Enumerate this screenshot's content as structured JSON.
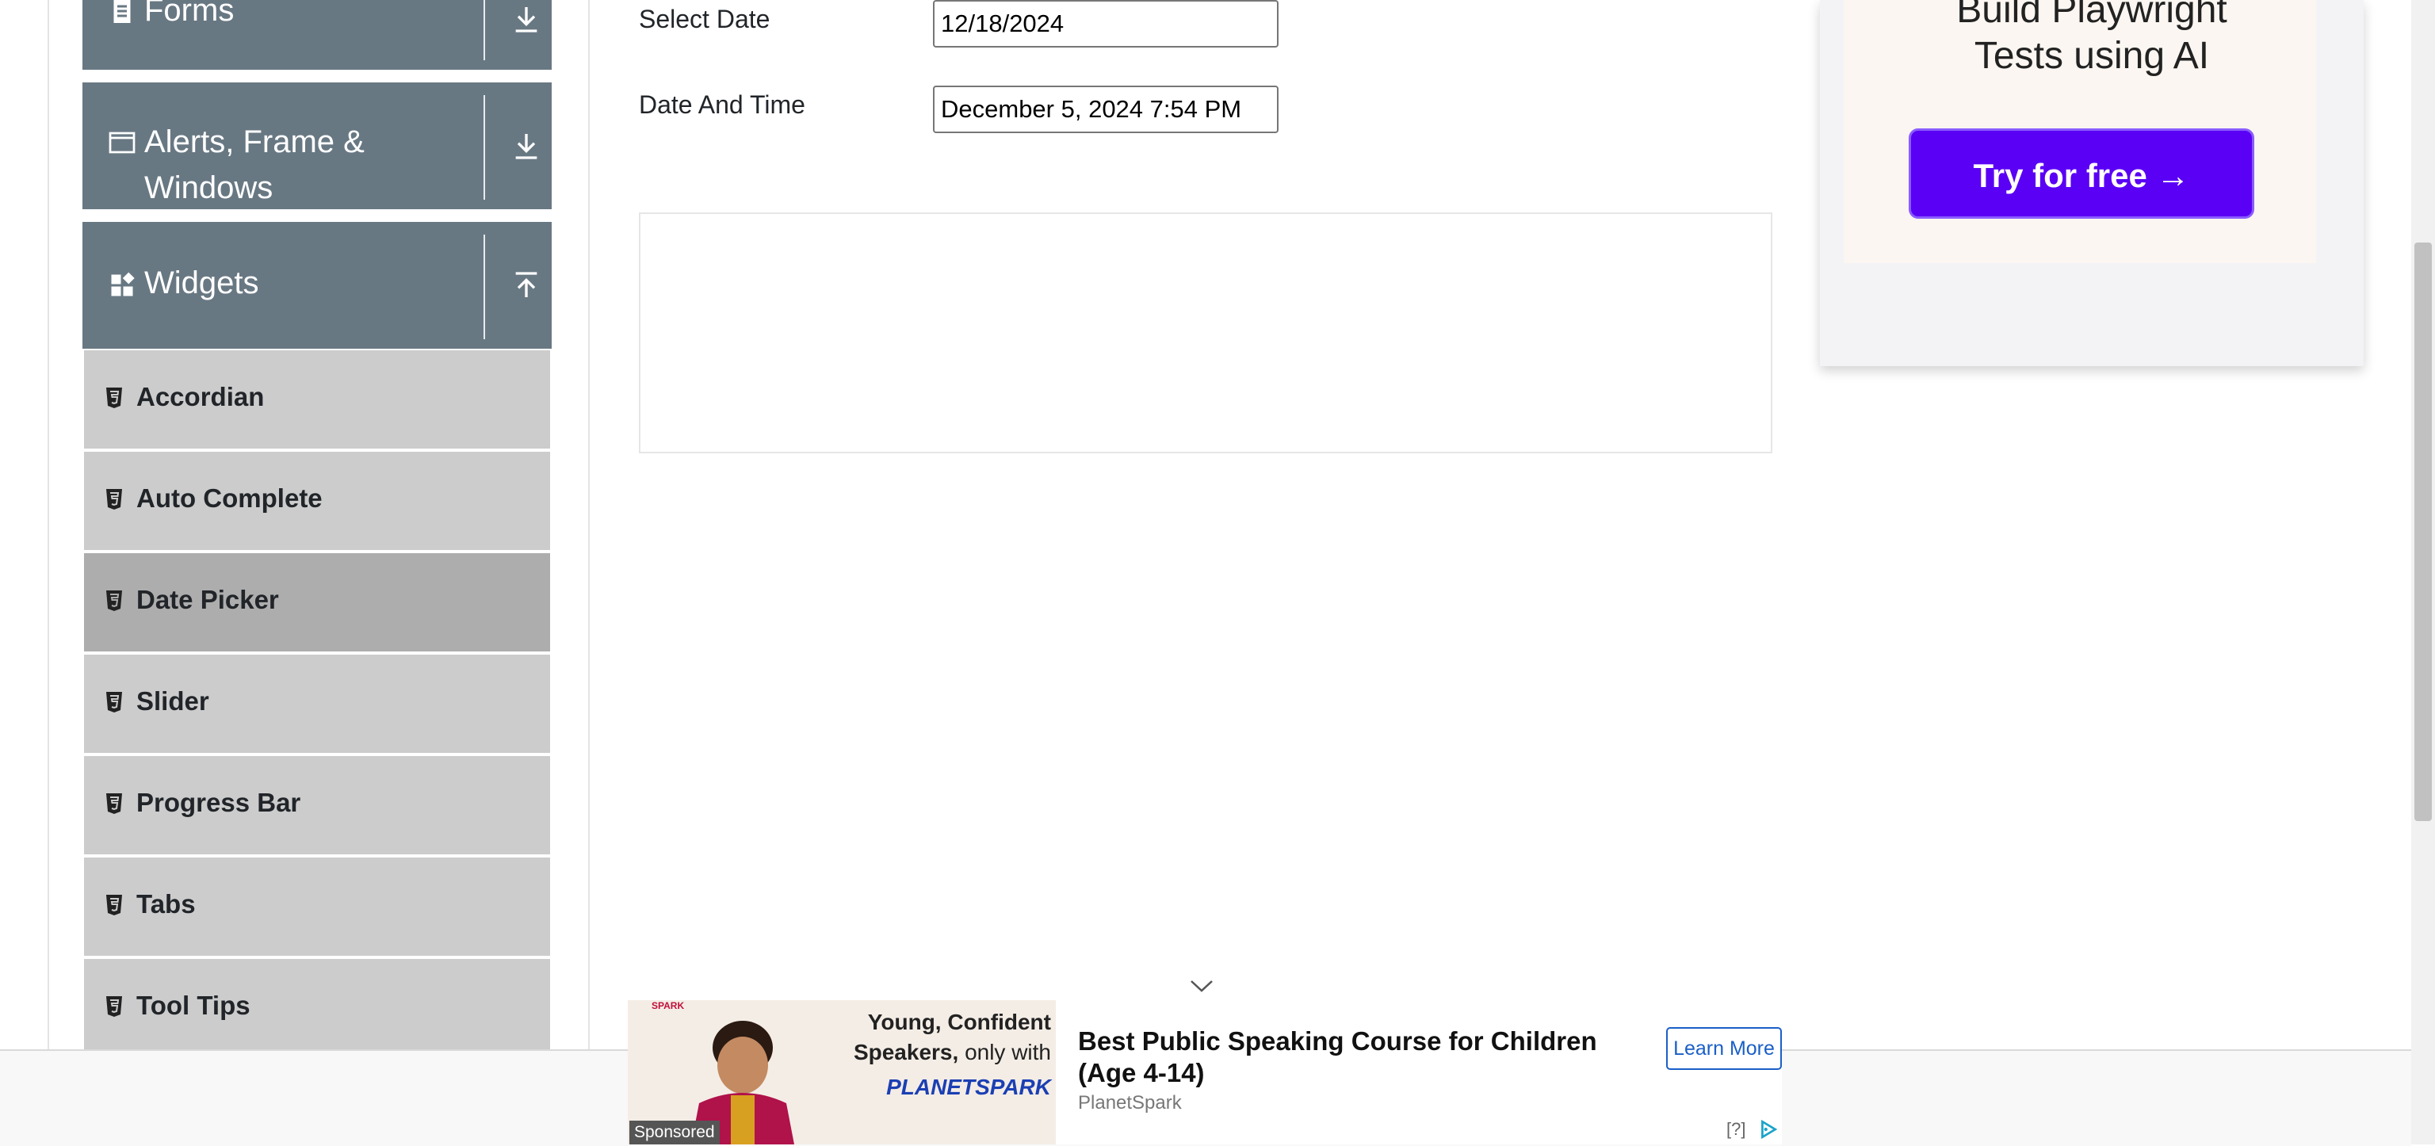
{
  "sidebar": {
    "forms_label": "Forms",
    "alerts_label_line1": "Alerts, Frame &",
    "alerts_label_line2": "Windows",
    "widgets_label": "Widgets",
    "items": [
      {
        "label": "Accordian"
      },
      {
        "label": "Auto Complete"
      },
      {
        "label": "Date Picker",
        "active": true
      },
      {
        "label": "Slider"
      },
      {
        "label": "Progress Bar"
      },
      {
        "label": "Tabs"
      },
      {
        "label": "Tool Tips"
      }
    ]
  },
  "form": {
    "select_date_label": "Select Date",
    "select_date_value": "12/18/2024",
    "date_time_label": "Date And Time",
    "date_time_value": "December 5, 2024 7:54 PM"
  },
  "right_ad": {
    "title_line1": "Build Playwright",
    "title_line2": "Tests using AI",
    "cta": "Try for free →"
  },
  "bottom_ad": {
    "image_text_line1": "Young, Confident",
    "image_text_line2a": "Speakers,",
    "image_text_line2b": "only with",
    "image_brand": "PLANETSPARK",
    "image_small_logo": "SPARK",
    "headline": "Best Public Speaking Course for Children (Age 4-14)",
    "advertiser": "PlanetSpark",
    "cta": "Learn More",
    "sponsored": "Sponsored",
    "adchoices": "[?]"
  },
  "colors": {
    "sidebar_header": "#687883",
    "sidebar_item": "#cccccc",
    "sidebar_item_active": "#adadad",
    "cta_purple": "#5a00f5",
    "learn_more_blue": "#1a5fc7"
  }
}
